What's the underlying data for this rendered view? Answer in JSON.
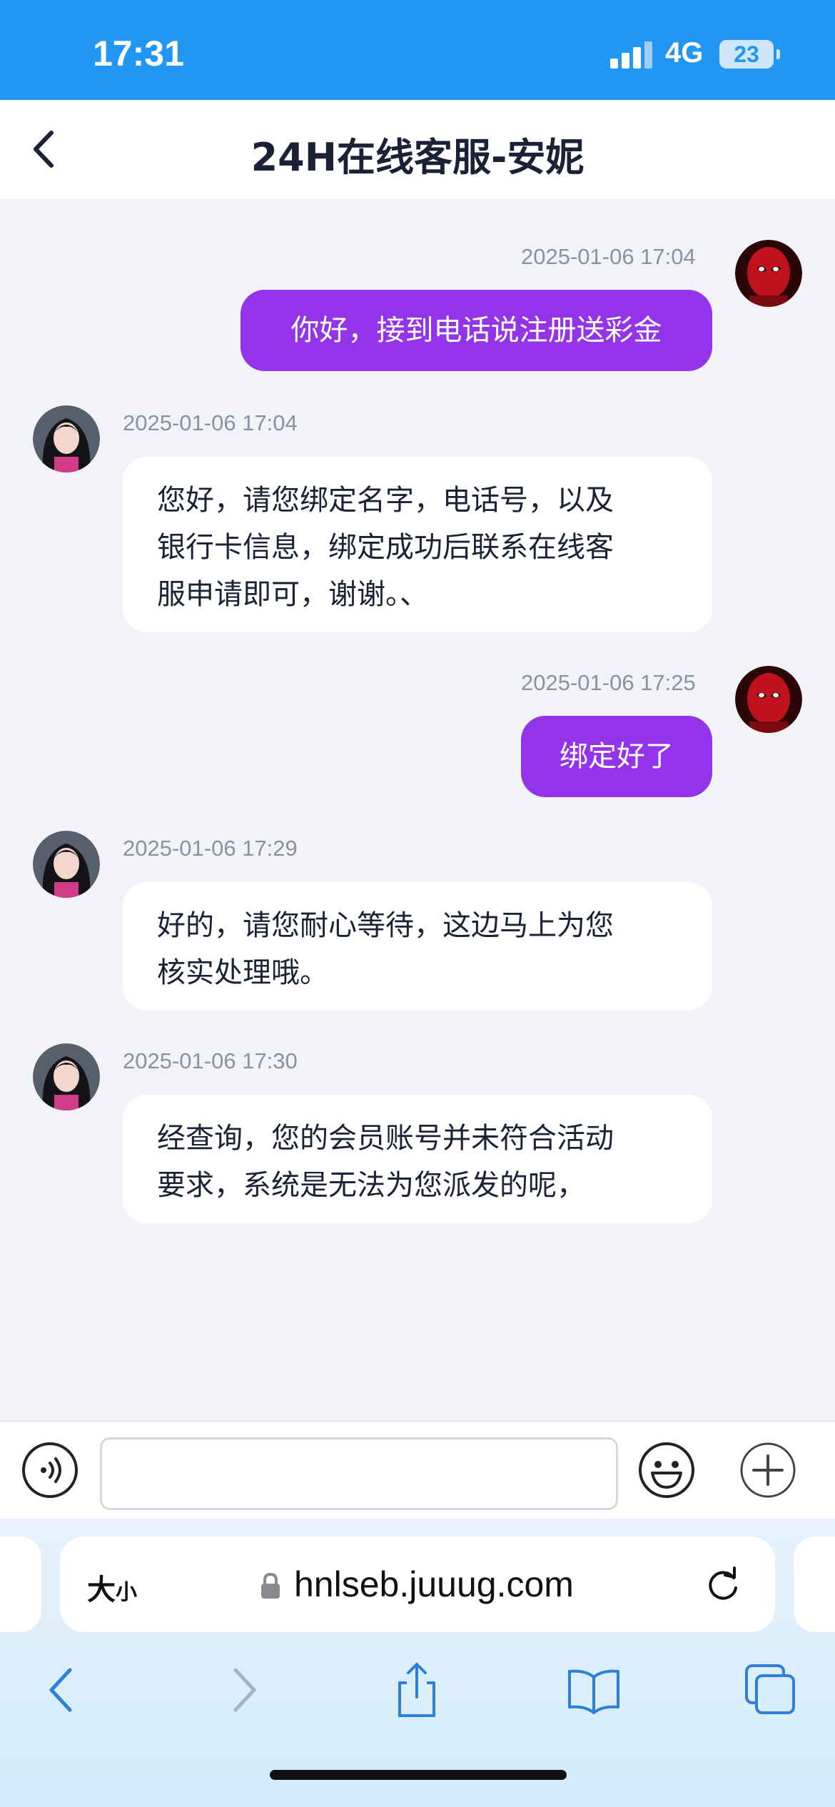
{
  "status_bar": {
    "time": "17:31",
    "network": "4G",
    "battery": "23"
  },
  "header": {
    "title": "24H在线客服-安妮",
    "back_icon": "chevron-left-icon"
  },
  "messages": [
    {
      "side": "out",
      "time": "2025-01-06 17:04",
      "text": "你好，接到电话说注册送彩金"
    },
    {
      "side": "in",
      "time": "2025-01-06 17:04",
      "lines": [
        "您好，请您绑定名字，电话号，以及",
        "银行卡信息，绑定成功后联系在线客",
        "服申请即可，谢谢。、"
      ]
    },
    {
      "side": "out",
      "time": "2025-01-06 17:25",
      "text": "绑定好了"
    },
    {
      "side": "in",
      "time": "2025-01-06 17:29",
      "lines": [
        "好的，请您耐心等待，这边马上为您",
        "核实处理哦。"
      ]
    },
    {
      "side": "in",
      "time": "2025-01-06 17:30",
      "lines": [
        "经查询，您的会员账号并未符合活动",
        "要求，系统是无法为您派发的呢，"
      ]
    }
  ],
  "input": {
    "value": "",
    "placeholder": "",
    "icons": [
      "voice-icon",
      "emoji-icon",
      "plus-icon"
    ]
  },
  "browser": {
    "text_size_big": "大",
    "text_size_small": "小",
    "url": "hnlseb.juuug.com",
    "toolbar_icons": [
      "back-icon",
      "forward-icon",
      "share-icon",
      "bookmarks-icon",
      "tabs-icon"
    ]
  },
  "colors": {
    "status_bar": "#2196f3",
    "outgoing_bubble": "#9333ea",
    "chat_bg": "#f2f3f8"
  }
}
